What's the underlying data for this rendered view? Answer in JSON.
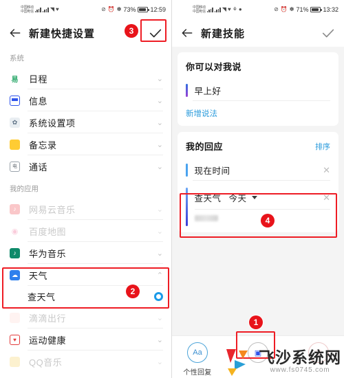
{
  "left": {
    "status": {
      "carrier_line1": "中国移动",
      "carrier_line2": "中国电信",
      "battery": "73%",
      "time": "12:59"
    },
    "appbar": {
      "title": "新建快捷设置",
      "back_icon": "back-arrow-icon",
      "confirm_icon": "check-icon"
    },
    "sections": [
      {
        "label": "系统",
        "items": [
          {
            "label": "日程",
            "icon": "calendar-icon",
            "glyph": "易",
            "dim": false
          },
          {
            "label": "信息",
            "icon": "message-icon",
            "glyph": "",
            "dim": false
          },
          {
            "label": "系统设置项",
            "icon": "settings-icon",
            "glyph": "✿",
            "dim": false
          },
          {
            "label": "备忘录",
            "icon": "memo-icon",
            "glyph": "",
            "dim": false
          },
          {
            "label": "通话",
            "icon": "phone-icon",
            "glyph": "电",
            "dim": false
          }
        ]
      },
      {
        "label": "我的应用",
        "items": [
          {
            "label": "网易云音乐",
            "icon": "netease-music-icon",
            "glyph": "♪",
            "dim": true
          },
          {
            "label": "百度地图",
            "icon": "baidu-map-icon",
            "glyph": "◉",
            "dim": true
          },
          {
            "label": "华为音乐",
            "icon": "huawei-music-icon",
            "glyph": "♪",
            "dim": false
          },
          {
            "label": "天气",
            "icon": "weather-icon",
            "glyph": "☁",
            "dim": false,
            "expanded": true,
            "children": [
              {
                "label": "查天气",
                "selected": true
              }
            ]
          },
          {
            "label": "滴滴出行",
            "icon": "didi-icon",
            "glyph": "",
            "dim": true
          },
          {
            "label": "运动健康",
            "icon": "health-icon",
            "glyph": "♥",
            "dim": false
          },
          {
            "label": "QQ音乐",
            "icon": "qq-music-icon",
            "glyph": "",
            "dim": true
          }
        ]
      }
    ],
    "chevron_down": "⌄",
    "chevron_up": "⌃"
  },
  "right": {
    "status": {
      "carrier_line1": "中国移动",
      "carrier_line2": "中国电信",
      "battery": "71%",
      "time": "13:32"
    },
    "appbar": {
      "title": "新建技能",
      "back_icon": "back-arrow-icon",
      "confirm_icon": "check-icon"
    },
    "say_card": {
      "title": "你可以对我说",
      "phrases": [
        {
          "text": "早上好"
        }
      ],
      "add_link": "新增说法"
    },
    "reply_card": {
      "title": "我的回应",
      "sort_link": "排序",
      "actions": [
        {
          "text": "现在时间",
          "close_icon": "close-icon"
        },
        {
          "text": "查天气",
          "selector_value": "今天",
          "close_icon": "close-icon",
          "has_blurred_value": true
        }
      ]
    },
    "tabbar": [
      {
        "label": "个性回复",
        "glyph": "Aa",
        "name": "tab-personal-reply"
      },
      {
        "label": "",
        "glyph": "▣",
        "name": "tab-app-action"
      },
      {
        "label": "",
        "glyph": "♡",
        "name": "tab-more"
      }
    ]
  },
  "annotations": {
    "badge1": "1",
    "badge2": "2",
    "badge3": "3",
    "badge4": "4"
  },
  "watermark": {
    "title": "飞沙系统网",
    "url": "www.fs0745.com"
  }
}
